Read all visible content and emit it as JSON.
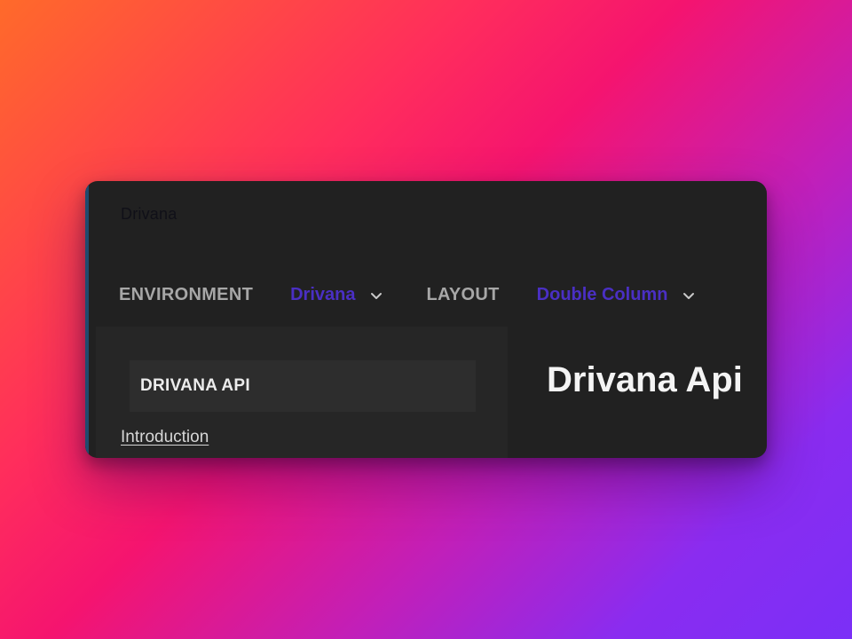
{
  "brand": {
    "logo_text": "Drivana"
  },
  "topbar": {
    "environment_label": "ENVIRONMENT",
    "environment_value": "Drivana",
    "layout_label": "LAYOUT",
    "layout_value": "Double Column"
  },
  "sidebar": {
    "section_title": "DRIVANA API",
    "items": [
      {
        "label": "Introduction"
      }
    ]
  },
  "main": {
    "title": "Drivana Api"
  },
  "colors": {
    "window_bg": "#212121",
    "sidebar_bg": "#262626",
    "accent_select": "#4a2fc4",
    "label_gray": "#a7a7a7"
  }
}
